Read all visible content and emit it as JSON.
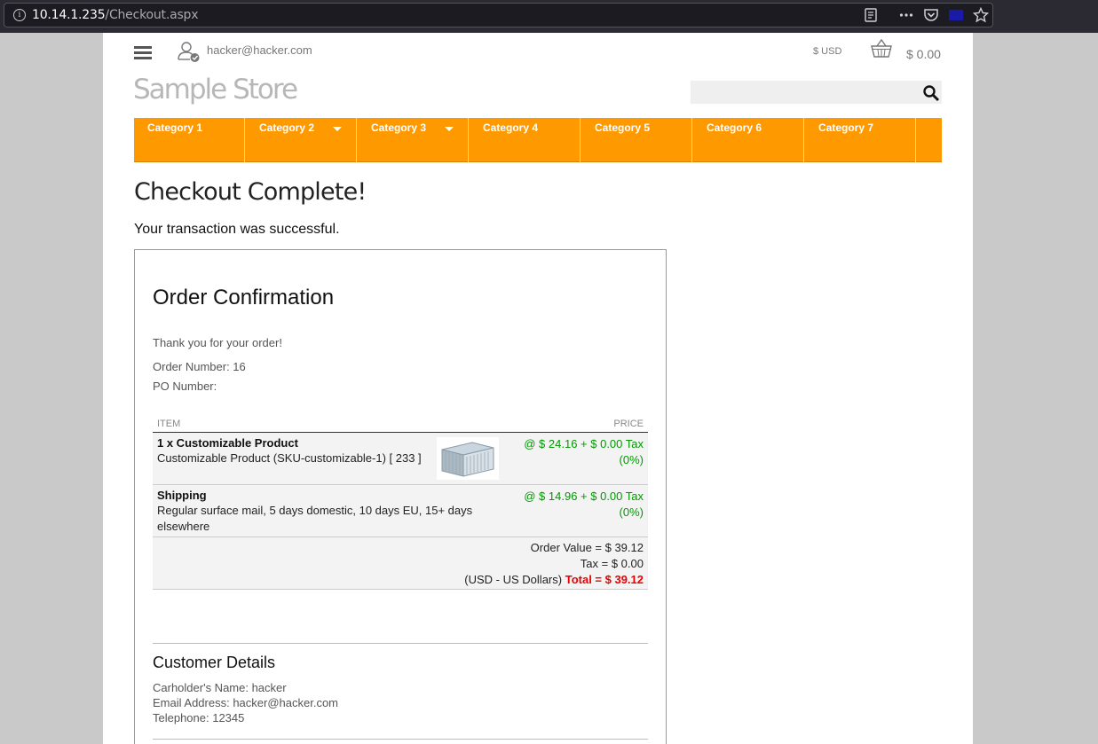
{
  "browser": {
    "url_host": "10.14.1.235",
    "url_path": "/Checkout.aspx"
  },
  "header": {
    "user_email": "hacker@hacker.com",
    "currency": "$ USD",
    "basket_total": "$ 0.00",
    "logo": "Sample Store",
    "search_placeholder": ""
  },
  "nav": {
    "items": [
      {
        "label": "Category 1",
        "dropdown": false
      },
      {
        "label": "Category 2",
        "dropdown": true
      },
      {
        "label": "Category 3",
        "dropdown": true
      },
      {
        "label": "Category 4",
        "dropdown": false
      },
      {
        "label": "Category 5",
        "dropdown": false
      },
      {
        "label": "Category 6",
        "dropdown": false
      },
      {
        "label": "Category 7",
        "dropdown": false
      }
    ]
  },
  "main": {
    "title": "Checkout Complete!",
    "message": "Your transaction was successful."
  },
  "confirmation": {
    "title": "Order Confirmation",
    "thanks": "Thank you for your order!",
    "order_number": "Order Number: 16",
    "po_number": "PO Number:",
    "table": {
      "col_item": "ITEM",
      "col_price": "PRICE",
      "product_name": "1 x Customizable Product",
      "product_desc": "Customizable Product (SKU-customizable-1) [ 233 ]",
      "product_price": "@ $ 24.16 + $ 0.00 Tax (0%)",
      "shipping_name": "Shipping",
      "shipping_desc": "Regular surface mail, 5 days domestic, 10 days EU, 15+ days elsewhere",
      "shipping_price": "@ $ 14.96 + $ 0.00 Tax (0%)",
      "order_value": "Order Value = $ 39.12",
      "tax": "Tax = $ 0.00",
      "currency_note": "(USD - US Dollars)",
      "total": "Total = $ 39.12"
    }
  },
  "customer": {
    "title": "Customer Details",
    "name": "Carholder's Name: hacker",
    "email": "Email Address: hacker@hacker.com",
    "telephone": "Telephone: 12345"
  },
  "colors": {
    "nav_bg": "#ff9900",
    "price_green": "#009900",
    "total_red": "#ee0000"
  }
}
